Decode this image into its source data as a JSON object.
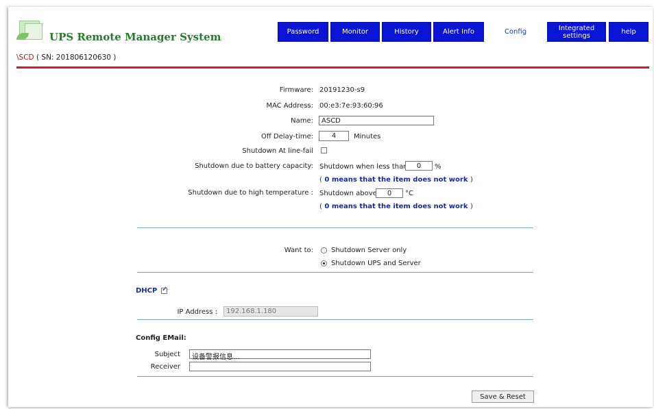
{
  "app": {
    "title": "UPS Remote Manager System"
  },
  "nav": {
    "password": "Password",
    "monitor": "Monitor",
    "history": "History",
    "alert_info": "Alert Info",
    "config": "Config",
    "integrated_1": "Integrated",
    "integrated_2": "settings",
    "help": "help"
  },
  "device": {
    "unit": "\\SCD",
    "serial": "( SN: 201806120630 )"
  },
  "config": {
    "firmware_label": "Firmware:",
    "firmware": "20191230-s9",
    "mac_label": "MAC Address:",
    "mac": "00:e3:7e:93:60:96",
    "name_label": "Name:",
    "name": "ASCD",
    "off_delay_label": "Off Delay-time:",
    "off_delay": "4",
    "off_delay_unit": "Minutes",
    "line_fail_label": "Shutdown At line-fail",
    "battery_label": "Shutdown due to battery capacity:",
    "battery_text": "Shutdown when less than",
    "battery_value": "0",
    "battery_unit": "%",
    "note_open": "(",
    "note": "0 means that the item does not work",
    "note_close": ")",
    "temp_label": "Shutdown due to high temperature :",
    "temp_text": "Shutdown above",
    "temp_value": "0",
    "temp_unit": "°C"
  },
  "shutdown": {
    "want_label": "Want to:",
    "option_server": "Shutdown Server only",
    "option_ups": "Shutdown UPS and Server",
    "selected": "Shutdown UPS and Server"
  },
  "network": {
    "dhcp_label": "DHCP",
    "dhcp_checked": true,
    "ip_label": "IP Address :",
    "ip": "192.168.1.180"
  },
  "email": {
    "section": "Config EMail:",
    "subject_label": "Subject",
    "subject": "设备警报信息...",
    "receiver_label": "Receiver",
    "receiver": ""
  },
  "actions": {
    "save_reset": "Save & Reset"
  },
  "colors": {
    "nav_bg": "#0a14d4",
    "title_green": "#2a7a2e",
    "accent_red": "#c81e1e",
    "note_blue": "#1a2a9a"
  }
}
